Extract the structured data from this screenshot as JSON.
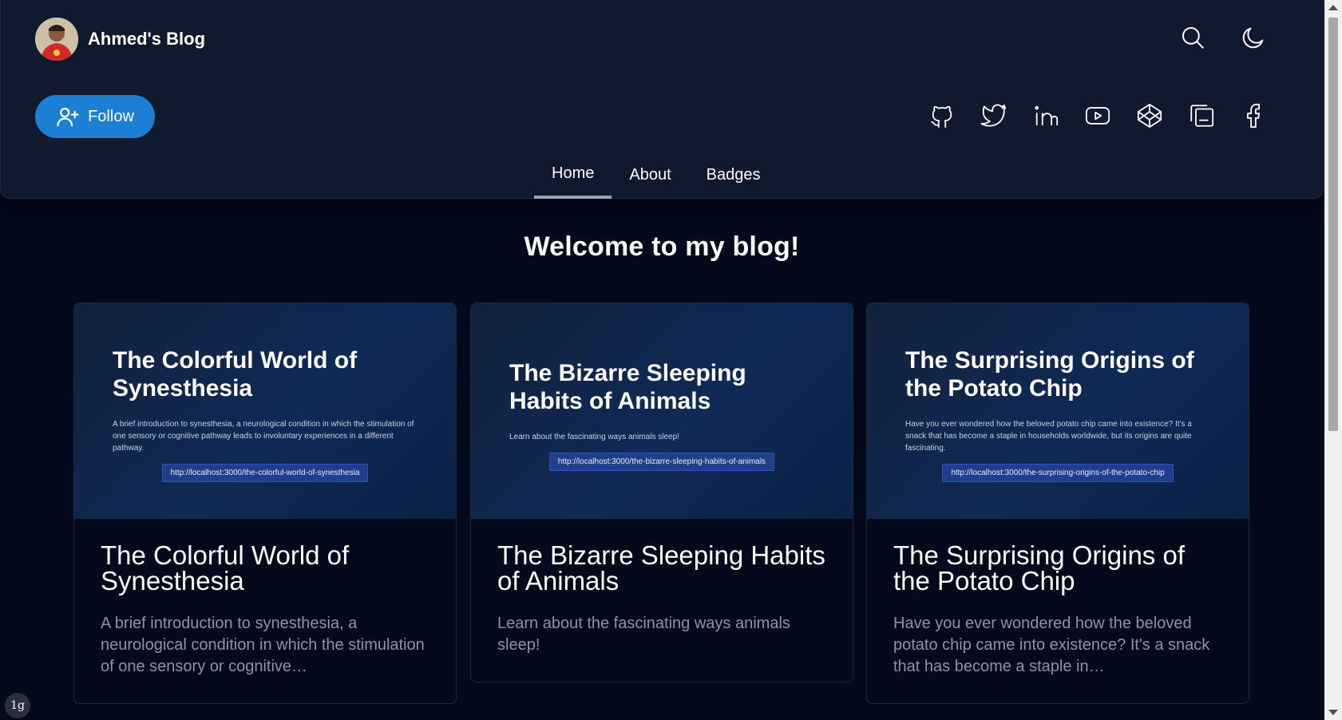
{
  "header": {
    "blog_name": "Ahmed's Blog",
    "follow_label": "Follow",
    "top_icons": [
      "search-icon",
      "moon-icon"
    ],
    "social_icons": [
      "github-icon",
      "twitter-icon",
      "linkedin-icon",
      "youtube-icon",
      "codepen-icon",
      "blog-pages-icon",
      "facebook-icon"
    ],
    "tabs": [
      {
        "label": "Home",
        "active": true
      },
      {
        "label": "About",
        "active": false
      },
      {
        "label": "Badges",
        "active": false
      }
    ]
  },
  "main": {
    "welcome": "Welcome to my blog!",
    "posts": [
      {
        "cover_title": "The Colorful World of Synesthesia",
        "cover_desc": "A brief introduction to synesthesia, a neurological condition in which the stimulation of one sensory or cognitive pathway leads to involuntary experiences in a different pathway.",
        "cover_link": "http://localhost:3000/the-colorful-world-of-synesthesia",
        "title": "The Colorful World of Synesthesia",
        "excerpt": "A brief introduction to synesthesia, a neurological condition in which the stimulation of one sensory or cognitive…"
      },
      {
        "cover_title": "The Bizarre Sleeping Habits of Animals",
        "cover_desc": "Learn about the fascinating ways animals sleep!",
        "cover_link": "http://localhost:3000/the-bizarre-sleeping-habits-of-animals",
        "title": "The Bizarre Sleeping Habits of Animals",
        "excerpt": "Learn about the fascinating ways animals sleep!"
      },
      {
        "cover_title": "The Surprising Origins of the Potato Chip",
        "cover_desc": "Have you ever wondered how the beloved potato chip came into existence? It's a snack that has become a staple in households worldwide, but its origins are quite fascinating.",
        "cover_link": "http://localhost:3000/the-surprising-origins-of-the-potato-chip",
        "title": "The Surprising Origins of the Potato Chip",
        "excerpt": "Have you ever wondered how the beloved potato chip came into existence? It's a snack that has become a staple in…"
      }
    ]
  },
  "overlay": {
    "lang_badge": "1g"
  },
  "colors": {
    "background": "#030a1c",
    "header_bg": "#101a2f",
    "accent": "#1d7fd1",
    "muted_text": "#8b93a5"
  }
}
